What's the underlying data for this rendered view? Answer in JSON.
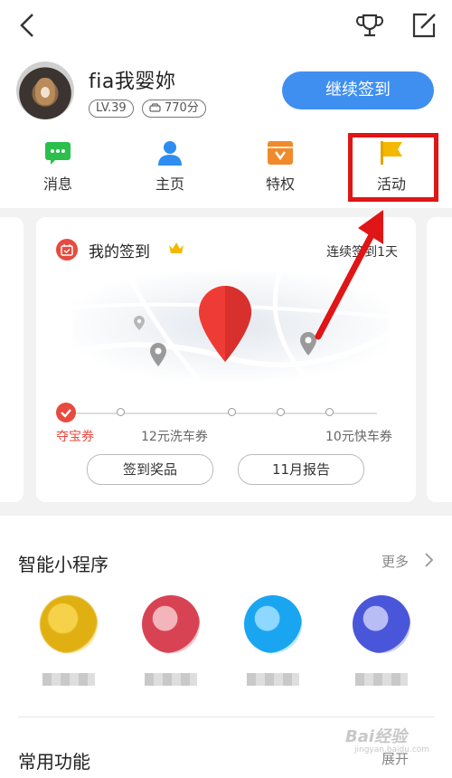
{
  "header": {
    "back_icon": "chevron-left-icon",
    "trophy_icon": "trophy-icon",
    "edit_icon": "edit-icon"
  },
  "profile": {
    "username": "fia我婴妳",
    "level": "LV.39",
    "points": "770分",
    "checkin_button": "继续签到"
  },
  "nav": [
    {
      "label": "消息",
      "icon": "message-icon",
      "color": "#2bbf4c"
    },
    {
      "label": "主页",
      "icon": "person-icon",
      "color": "#2f8cf0"
    },
    {
      "label": "特权",
      "icon": "privilege-icon",
      "color": "#f08a2b"
    },
    {
      "label": "活动",
      "icon": "flag-icon",
      "color": "#f5b800"
    }
  ],
  "checkin_card": {
    "title": "我的签到",
    "streak": "连续签到1天",
    "rewards": [
      "夺宝券",
      "12元洗车券",
      "10元快车券"
    ],
    "buttons": [
      "签到奖品",
      "11月报告"
    ]
  },
  "mini_programs": {
    "title": "智能小程序",
    "more": "更多"
  },
  "common_features": {
    "title": "常用功能",
    "expand": "展开"
  },
  "watermark": {
    "brand": "Bai经验",
    "url": "jingyan.baidu.com"
  },
  "colors": {
    "accent": "#3f8ff0",
    "highlight": "#e01515",
    "checkin_red": "#e84a3f"
  }
}
